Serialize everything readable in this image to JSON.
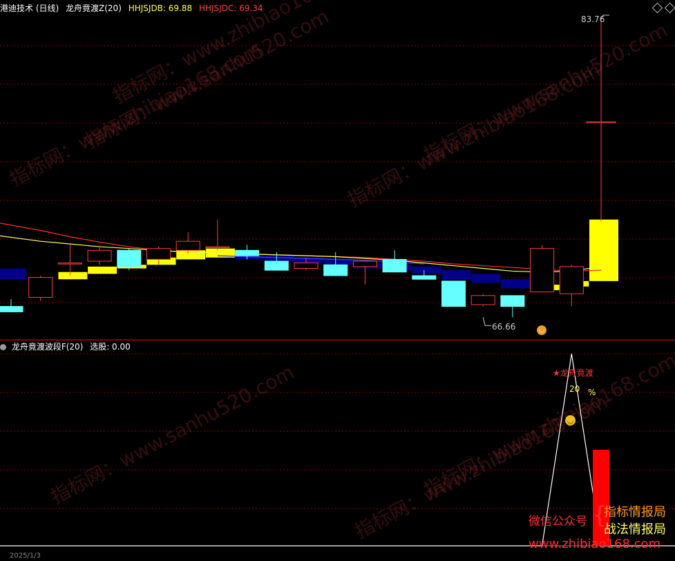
{
  "header": {
    "title": "港迪技术 (日线)",
    "indicator": "龙舟竟渡Z(20)",
    "hhjsjdb_label": "HHJSJDB: 69.88",
    "hhjsjdc_label": "HHJSJDC: 69.34"
  },
  "sub_header": {
    "indicator": "龙舟竟渡波段F(20)",
    "xuangu_label": "选股: 0.00"
  },
  "annotations": {
    "high": "83.76",
    "low": "66.66",
    "signal_name": "龙舟竟渡",
    "signal_value": "20",
    "signal_unit": "%"
  },
  "watermarks": [
    "指标网：www.zhibiao168.com",
    "指标网：www.sanhu520.com"
  ],
  "promo": {
    "wechat": "微信公众号",
    "line1": "指标情报局",
    "line2": "战法情报局",
    "url": "www.zhibiao168.com"
  },
  "footer_partial": "2025/1/3",
  "colors": {
    "up": "#ff4040",
    "down": "#66ffff",
    "ma_red": "#ff3030",
    "ma_yellow": "#ffff66",
    "ma_blue": "#3a3aff",
    "yellow_bar": "#ffff00",
    "navy_bar": "#00008b",
    "divider": "#b00000",
    "grid": "#8b0000"
  },
  "chart_data": {
    "type": "candlestick",
    "main_y_range": [
      66.0,
      85.0
    ],
    "candles": [
      {
        "o": 67.9,
        "h": 68.3,
        "l": 67.6,
        "c": 67.6
      },
      {
        "o": 68.4,
        "h": 69.6,
        "l": 68.2,
        "c": 69.5
      },
      {
        "o": 70.3,
        "h": 71.4,
        "l": 69.6,
        "c": 70.3
      },
      {
        "o": 70.4,
        "h": 71.2,
        "l": 70.2,
        "c": 71.0
      },
      {
        "o": 71.0,
        "h": 71.1,
        "l": 69.9,
        "c": 70.1
      },
      {
        "o": 70.5,
        "h": 71.2,
        "l": 70.2,
        "c": 71.1
      },
      {
        "o": 71.0,
        "h": 72.0,
        "l": 70.8,
        "c": 71.5
      },
      {
        "o": 71.2,
        "h": 72.7,
        "l": 71.0,
        "c": 71.2
      },
      {
        "o": 71.0,
        "h": 71.3,
        "l": 70.5,
        "c": 70.7
      },
      {
        "o": 70.4,
        "h": 70.9,
        "l": 69.9,
        "c": 69.9
      },
      {
        "o": 70.0,
        "h": 70.6,
        "l": 69.9,
        "c": 70.3
      },
      {
        "o": 70.2,
        "h": 70.9,
        "l": 69.6,
        "c": 69.6
      },
      {
        "o": 70.1,
        "h": 70.4,
        "l": 69.1,
        "c": 70.4
      },
      {
        "o": 70.5,
        "h": 71.0,
        "l": 69.8,
        "c": 69.8
      },
      {
        "o": 69.6,
        "h": 69.9,
        "l": 69.4,
        "c": 69.4
      },
      {
        "o": 69.3,
        "h": 69.3,
        "l": 67.9,
        "c": 67.9
      },
      {
        "o": 68.0,
        "h": 68.6,
        "l": 67.9,
        "c": 68.5
      },
      {
        "o": 68.5,
        "h": 68.5,
        "l": 67.3,
        "c": 67.9
      },
      {
        "o": 68.7,
        "h": 71.3,
        "l": 68.7,
        "c": 71.1
      },
      {
        "o": 68.6,
        "h": 70.2,
        "l": 67.9,
        "c": 70.1
      },
      {
        "o": 78.1,
        "h": 83.76,
        "l": 72.6,
        "c": 78.1
      }
    ],
    "ma_red": [
      72.5,
      72.1,
      71.75,
      71.45,
      71.2,
      71.0,
      70.9,
      70.85,
      70.8,
      70.75,
      70.7,
      70.65,
      70.6,
      70.5,
      70.4,
      70.25,
      70.15,
      70.05,
      69.95,
      69.85,
      69.9
    ],
    "ma_yellow": [
      71.8,
      71.5,
      71.35,
      71.2,
      71.1,
      71.0,
      70.9,
      70.85,
      70.8,
      70.75,
      70.7,
      70.65,
      70.55,
      70.45,
      70.3,
      70.15,
      70.0,
      69.85,
      69.8,
      69.85,
      70.1
    ],
    "ma_blue_idx": [
      7,
      8,
      9,
      10,
      11,
      12,
      13,
      14
    ],
    "band": [
      {
        "color": "navy",
        "lo": 69.4,
        "hi": 70.0
      },
      {
        "color": "none",
        "lo": 0,
        "hi": 0
      },
      {
        "color": "yellow",
        "lo": 69.4,
        "hi": 69.8
      },
      {
        "color": "yellow",
        "lo": 69.7,
        "hi": 70.1
      },
      {
        "color": "yellow",
        "lo": 70.0,
        "hi": 70.2
      },
      {
        "color": "yellow",
        "lo": 70.2,
        "hi": 70.6
      },
      {
        "color": "yellow",
        "lo": 70.5,
        "hi": 71.0
      },
      {
        "color": "yellow",
        "lo": 70.6,
        "hi": 71.1
      },
      {
        "color": "navy",
        "lo": 70.5,
        "hi": 70.8
      },
      {
        "color": "navy",
        "lo": 70.4,
        "hi": 70.7
      },
      {
        "color": "navy",
        "lo": 70.3,
        "hi": 70.6
      },
      {
        "color": "navy",
        "lo": 70.2,
        "hi": 70.5
      },
      {
        "color": "navy",
        "lo": 70.0,
        "hi": 70.3
      },
      {
        "color": "navy",
        "lo": 69.9,
        "hi": 70.2
      },
      {
        "color": "navy",
        "lo": 69.7,
        "hi": 70.1
      },
      {
        "color": "navy",
        "lo": 69.4,
        "hi": 69.9
      },
      {
        "color": "navy",
        "lo": 69.2,
        "hi": 69.7
      },
      {
        "color": "navy",
        "lo": 68.9,
        "hi": 69.4
      },
      {
        "color": "yellow",
        "lo": 68.8,
        "hi": 69.1
      },
      {
        "color": "yellow",
        "lo": 69.0,
        "hi": 69.3
      },
      {
        "color": "yellow",
        "lo": 69.3,
        "hi": 72.7
      }
    ],
    "sub_line": [
      0,
      0,
      0,
      0,
      0,
      0,
      0,
      0,
      0,
      0,
      0,
      0,
      0,
      0,
      0,
      0,
      0,
      0,
      0,
      100,
      0
    ],
    "sub_bar": {
      "index": 20,
      "value": 50
    }
  }
}
